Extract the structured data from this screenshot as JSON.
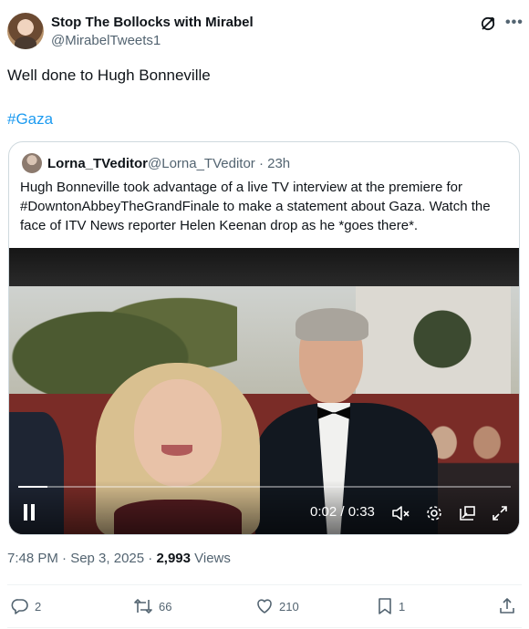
{
  "tweet": {
    "author_name": "Stop The Bollocks with Mirabel",
    "author_handle": "@MirabelTweets1",
    "text": "Well done to Hugh Bonneville",
    "hashtag": "#Gaza"
  },
  "quote": {
    "author_name": "Lorna_TVeditor",
    "author_handle_time": "@Lorna_TVeditor · 23h",
    "text": "Hugh Bonneville took advantage of a live TV interview at the premiere for #DowntonAbbeyTheGrandFinale to make a statement about Gaza. Watch the face of ITV News reporter Helen Keenan drop as he *goes there*."
  },
  "video": {
    "time_display": "0:02 / 0:33",
    "progress_fraction": 0.06,
    "controls": [
      "pause-icon",
      "mute-icon",
      "settings-icon",
      "pip-icon",
      "fullscreen-icon"
    ]
  },
  "meta": {
    "timestamp": "7:48 PM · Sep 3, 2025 · ",
    "views_count": "2,993",
    "views_label": " Views"
  },
  "actions": {
    "replies": "2",
    "reposts": "66",
    "likes": "210",
    "bookmarks": "1"
  },
  "colors": {
    "accent": "#1d9bf0",
    "secondary_text": "#536471",
    "border": "#cfd9de"
  }
}
